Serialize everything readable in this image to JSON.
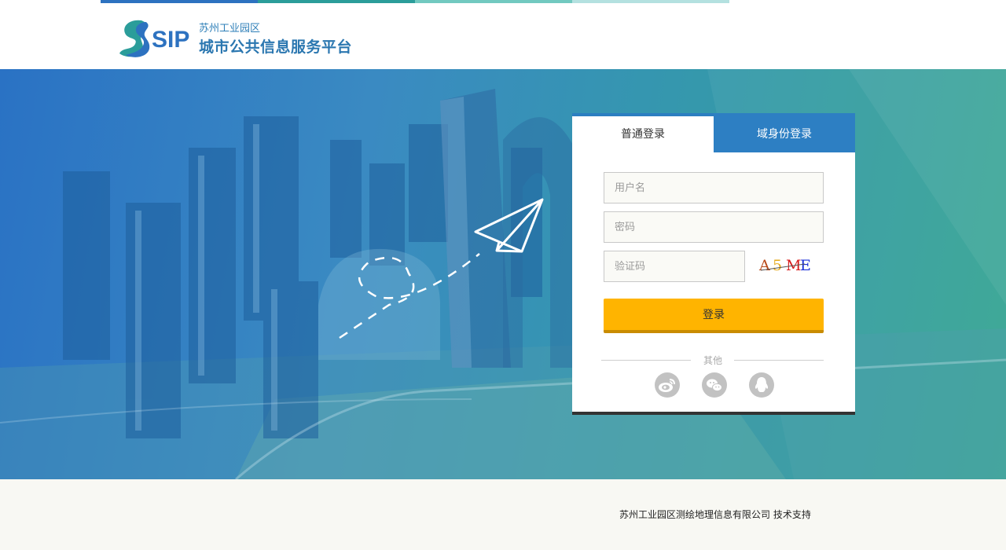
{
  "brand": {
    "logo_text": "SIP",
    "subtitle": "苏州工业园区",
    "title": "城市公共信息服务平台",
    "stripe_colors": [
      "#2d72c0",
      "#2b9d9a",
      "#72c9c0",
      "#b4e1e0"
    ]
  },
  "login": {
    "tabs": [
      {
        "label": "普通登录",
        "active": true
      },
      {
        "label": "域身份登录",
        "active": false
      }
    ],
    "username_placeholder": "用户名",
    "password_placeholder": "密码",
    "captcha_placeholder": "验证码",
    "captcha_text": "A5ME",
    "submit_label": "登录",
    "other_label": "其他",
    "social": [
      {
        "name": "weibo-icon"
      },
      {
        "name": "wechat-icon"
      },
      {
        "name": "qq-icon"
      }
    ]
  },
  "colors": {
    "accent_blue": "#2d7fc3",
    "button_yellow": "#ffb400"
  },
  "footer": {
    "text": "苏州工业园区测绘地理信息有限公司  技术支持"
  }
}
